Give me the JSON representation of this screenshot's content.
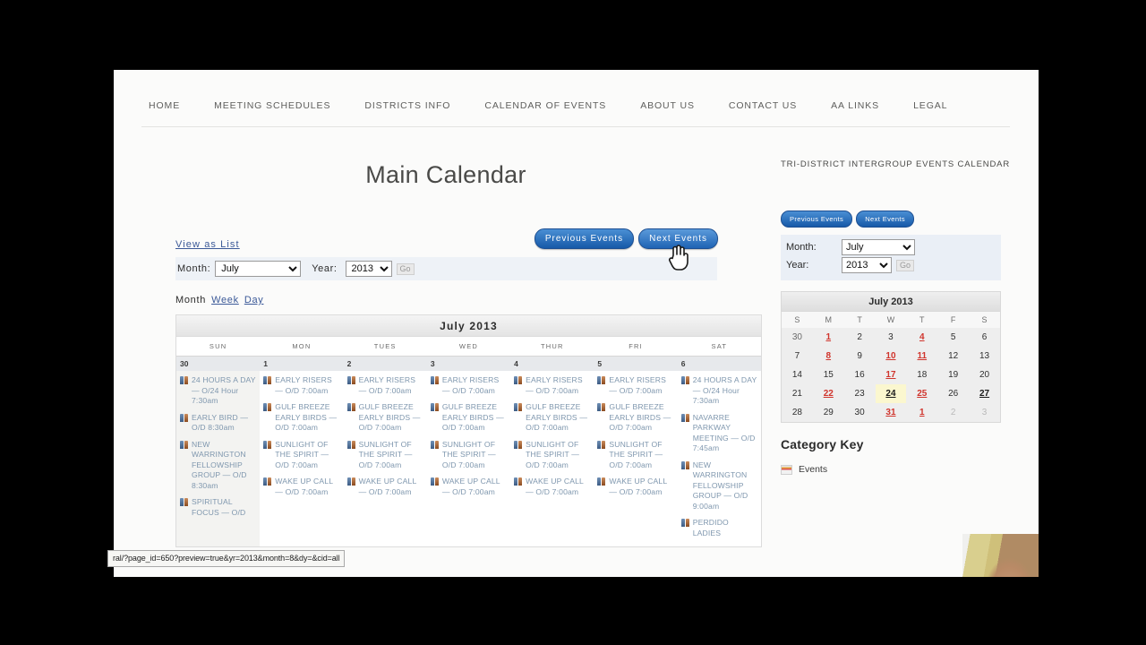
{
  "nav": {
    "items": [
      {
        "label": "HOME",
        "name": "nav-home"
      },
      {
        "label": "MEETING SCHEDULES",
        "name": "nav-meeting-schedules"
      },
      {
        "label": "DISTRICTS INFO",
        "name": "nav-districts-info"
      },
      {
        "label": "CALENDAR OF EVENTS",
        "name": "nav-calendar-of-events"
      },
      {
        "label": "ABOUT US",
        "name": "nav-about-us"
      },
      {
        "label": "CONTACT US",
        "name": "nav-contact-us"
      },
      {
        "label": "AA LINKS",
        "name": "nav-aa-links"
      },
      {
        "label": "LEGAL",
        "name": "nav-legal"
      }
    ]
  },
  "main": {
    "title": "Main Calendar",
    "view_as_list": "View as List",
    "month_label": "Month:",
    "year_label": "Year:",
    "month_value": "July",
    "year_value": "2013",
    "go_label": "Go",
    "previous_events": "Previous  Events",
    "next_events": "Next  Events",
    "view_tabs": {
      "month": "Month",
      "week": "Week",
      "day": "Day"
    },
    "calendar_caption": "July  2013",
    "day_headers": [
      "SUN",
      "MON",
      "TUES",
      "WED",
      "THUR",
      "FRI",
      "SAT"
    ],
    "dates": [
      "30",
      "1",
      "2",
      "3",
      "4",
      "5",
      "6"
    ],
    "columns": [
      {
        "day": "SUN",
        "events": [
          "24 HOURS A DAY — O/24 Hour 7:30am",
          "EARLY BIRD — O/D 8:30am",
          "NEW WARRINGTON FELLOWSHIP GROUP — O/D 8:30am",
          "SPIRITUAL FOCUS — O/D"
        ]
      },
      {
        "day": "MON",
        "events": [
          "EARLY RISERS — O/D 7:00am",
          "GULF BREEZE EARLY BIRDS — O/D 7:00am",
          "SUNLIGHT OF THE SPIRIT — O/D 7:00am",
          "WAKE UP CALL — O/D 7:00am"
        ]
      },
      {
        "day": "TUES",
        "events": [
          "EARLY RISERS — O/D 7:00am",
          "GULF BREEZE EARLY BIRDS — O/D 7:00am",
          "SUNLIGHT OF THE SPIRIT — O/D 7:00am",
          "WAKE UP CALL — O/D 7:00am"
        ]
      },
      {
        "day": "WED",
        "events": [
          "EARLY RISERS — O/D 7:00am",
          "GULF BREEZE EARLY BIRDS — O/D 7:00am",
          "SUNLIGHT OF THE SPIRIT — O/D 7:00am",
          "WAKE UP CALL — O/D 7:00am"
        ]
      },
      {
        "day": "THUR",
        "events": [
          "EARLY RISERS — O/D 7:00am",
          "GULF BREEZE EARLY BIRDS — O/D 7:00am",
          "SUNLIGHT OF THE SPIRIT — O/D 7:00am",
          "WAKE UP CALL — O/D 7:00am"
        ]
      },
      {
        "day": "FRI",
        "events": [
          "EARLY RISERS — O/D 7:00am",
          "GULF BREEZE EARLY BIRDS — O/D 7:00am",
          "SUNLIGHT OF THE SPIRIT — O/D 7:00am",
          "WAKE UP CALL — O/D 7:00am"
        ]
      },
      {
        "day": "SAT",
        "events": [
          "24 HOURS A DAY — O/24 Hour 7:30am",
          "NAVARRE PARKWAY MEETING — O/D 7:45am",
          "NEW WARRINGTON FELLOWSHIP GROUP — O/D 9:00am",
          "PERDIDO LADIES"
        ]
      }
    ]
  },
  "sidebar": {
    "title": "TRI-DISTRICT INTERGROUP EVENTS CALENDAR",
    "previous_events": "Previous Events",
    "next_events": "Next Events",
    "month_label": "Month:",
    "year_label": "Year:",
    "month_value": "July",
    "year_value": "2013",
    "go_label": "Go",
    "minical_caption": "July 2013",
    "minical_headers": [
      "S",
      "M",
      "T",
      "W",
      "T",
      "F",
      "S"
    ],
    "minical_weeks": [
      [
        {
          "d": "30",
          "style": "othermonth"
        },
        {
          "d": "1",
          "style": "red"
        },
        {
          "d": "2",
          "style": ""
        },
        {
          "d": "3",
          "style": ""
        },
        {
          "d": "4",
          "style": "red"
        },
        {
          "d": "5",
          "style": ""
        },
        {
          "d": "6",
          "style": ""
        }
      ],
      [
        {
          "d": "7",
          "style": ""
        },
        {
          "d": "8",
          "style": "red"
        },
        {
          "d": "9",
          "style": ""
        },
        {
          "d": "10",
          "style": "red"
        },
        {
          "d": "11",
          "style": "red"
        },
        {
          "d": "12",
          "style": ""
        },
        {
          "d": "13",
          "style": ""
        }
      ],
      [
        {
          "d": "14",
          "style": ""
        },
        {
          "d": "15",
          "style": ""
        },
        {
          "d": "16",
          "style": ""
        },
        {
          "d": "17",
          "style": "red"
        },
        {
          "d": "18",
          "style": ""
        },
        {
          "d": "19",
          "style": ""
        },
        {
          "d": "20",
          "style": ""
        }
      ],
      [
        {
          "d": "21",
          "style": ""
        },
        {
          "d": "22",
          "style": "red"
        },
        {
          "d": "23",
          "style": ""
        },
        {
          "d": "24",
          "style": "today"
        },
        {
          "d": "25",
          "style": "red"
        },
        {
          "d": "26",
          "style": ""
        },
        {
          "d": "27",
          "style": "boldu"
        }
      ],
      [
        {
          "d": "28",
          "style": ""
        },
        {
          "d": "29",
          "style": ""
        },
        {
          "d": "30",
          "style": ""
        },
        {
          "d": "31",
          "style": "red"
        },
        {
          "d": "1",
          "style": "red"
        },
        {
          "d": "2",
          "style": "mute"
        },
        {
          "d": "3",
          "style": "mute"
        }
      ]
    ],
    "category_key_title": "Category Key",
    "category_key_item": "Events"
  },
  "statusbar": {
    "url": "ral/?page_id=650?preview=true&yr=2013&month=8&dy=&cid=all"
  },
  "colors": {
    "accent_blue": "#1659a8",
    "link_blue": "#3b5998",
    "event_text": "#7f97ae",
    "today_highlight": "#fbf7cf",
    "red_date": "#d0342c"
  }
}
